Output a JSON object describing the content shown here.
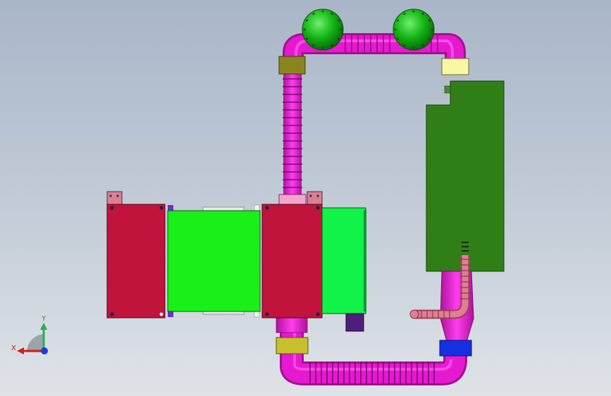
{
  "viewport": {
    "background_top": "#a9b6c8",
    "background_bottom": "#dfe3e8"
  },
  "triad": {
    "x_label": "X",
    "y_label": "Y",
    "x_color": "#d81e1e",
    "y_color": "#22b14c",
    "z_color": "#1f3bd6"
  },
  "colors": {
    "pipe": "#e619d1",
    "pipe_dark": "#a3108f",
    "sphere": "#14b514",
    "red_box": "#c0143c",
    "green_box": "#18f018",
    "dark_green_tank": "#2f7f16",
    "olive_flange": "#8a861e",
    "yellow_flange": "#c7bf2c",
    "pale_yellow_flange": "#fbf6a2",
    "blue_block": "#1430e0",
    "purple_block": "#4f1d7a",
    "pink_pipe": "#e07e96"
  },
  "components": [
    "green-sphere-left",
    "green-sphere-right",
    "vertical-pipe",
    "top-pipe-loop",
    "bottom-pipe-loop",
    "red-box-left",
    "green-box-center",
    "red-box-center",
    "green-box-right",
    "dark-green-tank",
    "blue-block",
    "purple-block",
    "small-pink-pipe"
  ]
}
